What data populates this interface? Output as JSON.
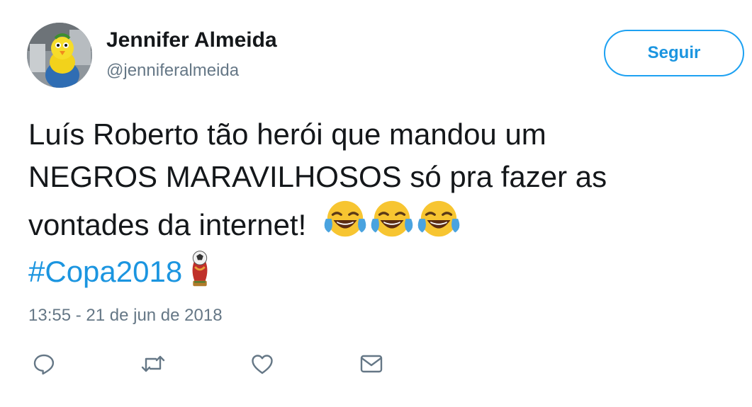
{
  "tweet": {
    "display_name": "Jennifer Almeida",
    "handle": "@jenniferalmeida",
    "follow_label": "Seguir",
    "text_lines": [
      "Luís Roberto tão herói que mandou um",
      "NEGROS MARAVILHOSOS só pra fazer as",
      "vontades da internet!"
    ],
    "emojis": [
      "face-with-tears-of-joy",
      "face-with-tears-of-joy",
      "face-with-tears-of-joy"
    ],
    "hashtag": "#Copa2018",
    "hashtag_emoji": "world-cup-trophy",
    "timestamp": "13:55 - 21 de jun de 2018"
  },
  "actions": [
    "reply-icon",
    "retweet-icon",
    "like-icon",
    "direct-message-icon"
  ],
  "colors": {
    "link": "#1b95e0",
    "button_border": "#1da1f2",
    "secondary_text": "#657786",
    "primary_text": "#14171a",
    "icon": "#657786"
  }
}
